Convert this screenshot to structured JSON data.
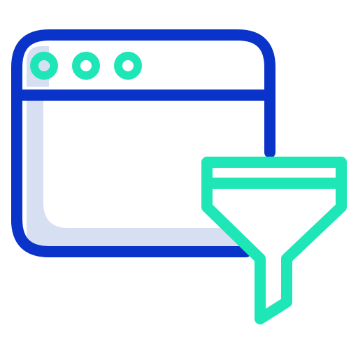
{
  "icon": {
    "name": "browser-filter-icon",
    "parts": {
      "window": "browser-window-icon",
      "dots": "window-dots-icon",
      "filter": "funnel-filter-icon"
    },
    "colors": {
      "outline": "#0a34c9",
      "accent": "#1ee6b6",
      "shadow_fill": "#d6e0f2",
      "background": "#ffffff"
    }
  }
}
